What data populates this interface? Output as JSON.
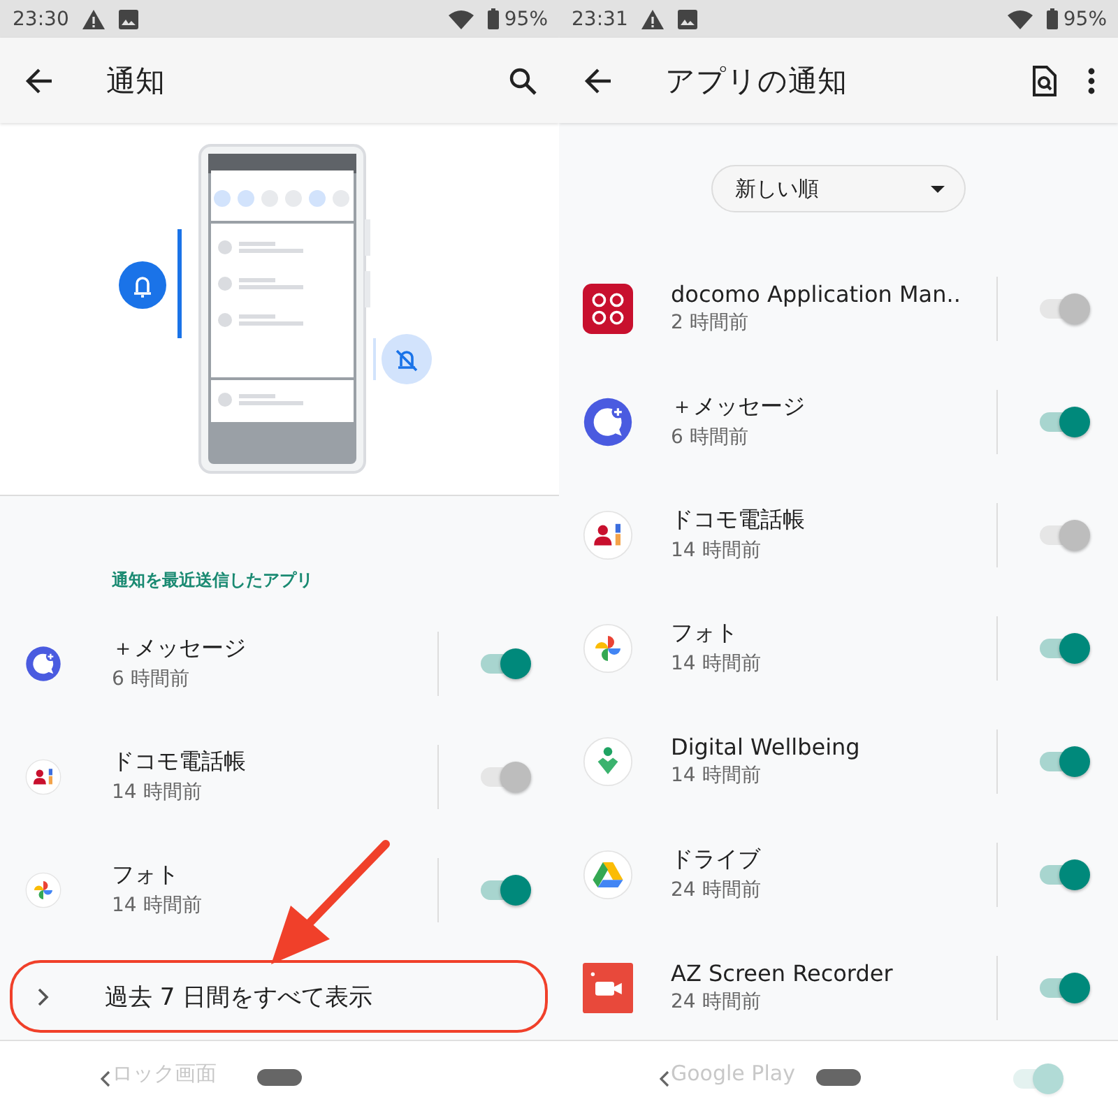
{
  "left_screen": {
    "status_bar": {
      "time": "23:30",
      "battery": "95%"
    },
    "app_bar": {
      "title": "通知",
      "actions": [
        {
          "kind": "search"
        }
      ]
    },
    "section_header": "通知を最近送信したアプリ",
    "apps": [
      {
        "kind": "message",
        "name": "＋メッセージ",
        "time": "6 時間前",
        "on": true,
        "disabled": false
      },
      {
        "kind": "contacts",
        "name": "ドコモ電話帳",
        "time": "14 時間前",
        "on": true,
        "disabled": true
      },
      {
        "kind": "photos",
        "name": "フォト",
        "time": "14 時間前",
        "on": true,
        "disabled": false
      }
    ],
    "see_all": {
      "label": "過去 7 日間をすべて表示",
      "highlighted": true
    },
    "nav_bar": {
      "peek": "ロック画面"
    }
  },
  "right_screen": {
    "status_bar": {
      "time": "23:31",
      "battery": "95%"
    },
    "app_bar": {
      "title": "アプリの通知",
      "actions": [
        {
          "kind": "find_in_page"
        },
        {
          "kind": "more"
        }
      ]
    },
    "sort": {
      "value": "新しい順"
    },
    "apps": [
      {
        "kind": "docomo",
        "name": "docomo Application Man..",
        "time": "2 時間前",
        "on": true,
        "disabled": true
      },
      {
        "kind": "message",
        "name": "＋メッセージ",
        "time": "6 時間前",
        "on": true,
        "disabled": false
      },
      {
        "kind": "contacts",
        "name": "ドコモ電話帳",
        "time": "14 時間前",
        "on": true,
        "disabled": true
      },
      {
        "kind": "photos",
        "name": "フォト",
        "time": "14 時間前",
        "on": true,
        "disabled": false
      },
      {
        "kind": "wellbeing",
        "name": "Digital Wellbeing",
        "time": "14 時間前",
        "on": true,
        "disabled": false
      },
      {
        "kind": "drive",
        "name": "ドライブ",
        "time": "24 時間前",
        "on": true,
        "disabled": false
      },
      {
        "kind": "recorder",
        "name": "AZ Screen Recorder",
        "time": "24 時間前",
        "on": true,
        "disabled": false
      }
    ],
    "nav_bar": {
      "peek": "Google Play",
      "peek_on": true
    }
  }
}
